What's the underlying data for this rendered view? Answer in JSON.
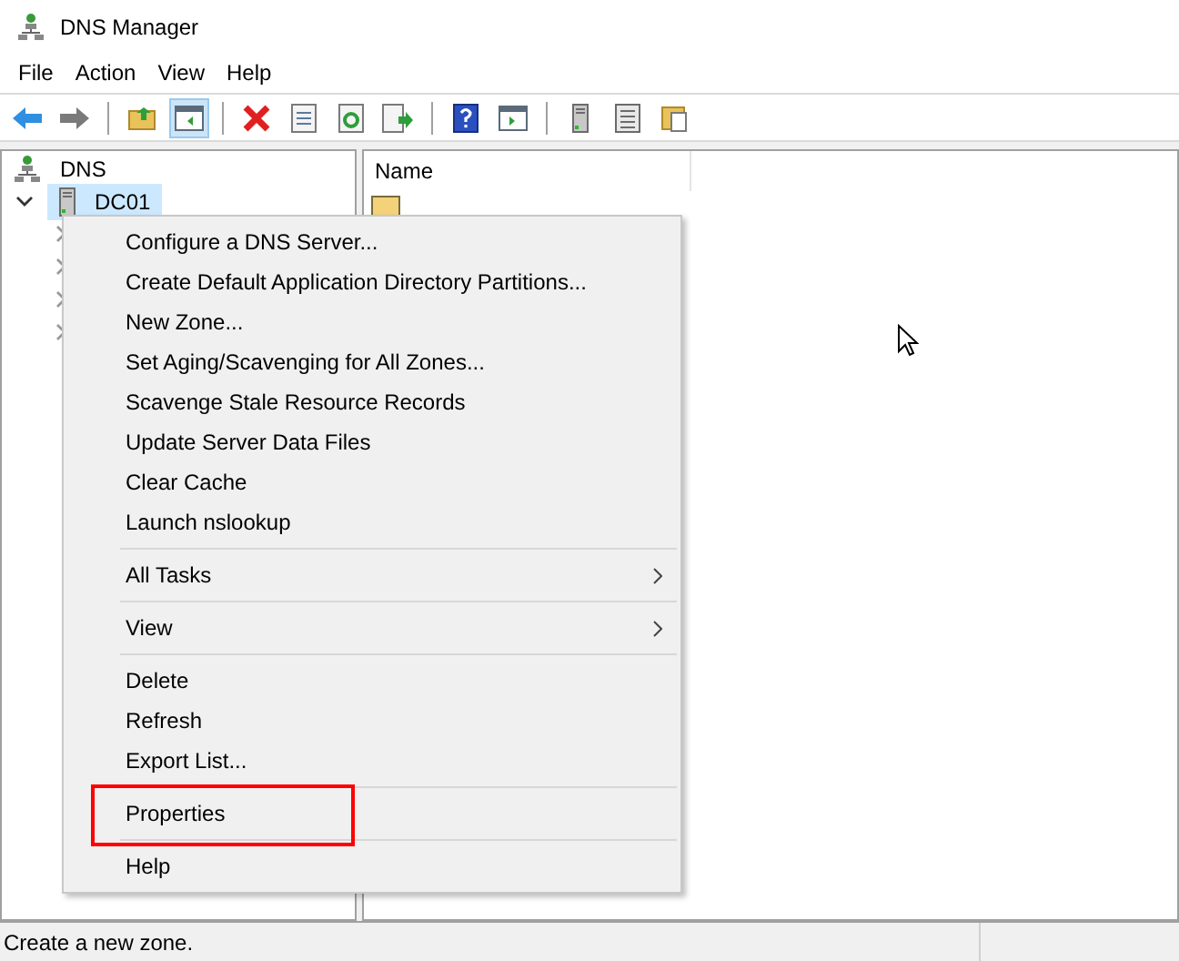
{
  "window": {
    "title": "DNS Manager"
  },
  "menu_bar": [
    "File",
    "Action",
    "View",
    "Help"
  ],
  "toolbar": [
    {
      "kind": "back",
      "selected": false
    },
    {
      "kind": "forward",
      "selected": false
    },
    {
      "kind": "separator"
    },
    {
      "kind": "up",
      "selected": false
    },
    {
      "kind": "tree",
      "selected": true
    },
    {
      "kind": "separator"
    },
    {
      "kind": "delete",
      "selected": false
    },
    {
      "kind": "properties",
      "selected": false
    },
    {
      "kind": "refresh",
      "selected": false
    },
    {
      "kind": "export",
      "selected": false
    },
    {
      "kind": "separator"
    },
    {
      "kind": "help",
      "selected": false
    },
    {
      "kind": "pane",
      "selected": false
    },
    {
      "kind": "separator"
    },
    {
      "kind": "server",
      "selected": false
    },
    {
      "kind": "list",
      "selected": false
    },
    {
      "kind": "folders",
      "selected": false
    }
  ],
  "tree": [
    {
      "label": "DNS",
      "selected": false,
      "children": [
        {
          "label": "DC01",
          "selected": true,
          "expanded": true,
          "children": [
            {
              "expanded": false
            },
            {
              "expanded": false
            },
            {
              "expanded": false
            },
            {
              "expanded": false
            }
          ]
        }
      ]
    }
  ],
  "list": {
    "columns": [
      "Name"
    ],
    "rows": [
      {
        "kind": "folder"
      }
    ]
  },
  "context_menu": [
    {
      "kind": "item",
      "label": "Configure a DNS Server...",
      "submenu": false,
      "highlighted": false
    },
    {
      "kind": "item",
      "label": "Create Default Application Directory Partitions...",
      "submenu": false,
      "highlighted": false
    },
    {
      "kind": "item",
      "label": "New Zone...",
      "submenu": false,
      "highlighted": false
    },
    {
      "kind": "item",
      "label": "Set Aging/Scavenging for All Zones...",
      "submenu": false,
      "highlighted": false
    },
    {
      "kind": "item",
      "label": "Scavenge Stale Resource Records",
      "submenu": false,
      "highlighted": false
    },
    {
      "kind": "item",
      "label": "Update Server Data Files",
      "submenu": false,
      "highlighted": false
    },
    {
      "kind": "item",
      "label": "Clear Cache",
      "submenu": false,
      "highlighted": false
    },
    {
      "kind": "item",
      "label": "Launch nslookup",
      "submenu": false,
      "highlighted": false
    },
    {
      "kind": "separator"
    },
    {
      "kind": "item",
      "label": "All Tasks",
      "submenu": true,
      "highlighted": false
    },
    {
      "kind": "separator"
    },
    {
      "kind": "item",
      "label": "View",
      "submenu": true,
      "highlighted": false
    },
    {
      "kind": "separator"
    },
    {
      "kind": "item",
      "label": "Delete",
      "submenu": false,
      "highlighted": false
    },
    {
      "kind": "item",
      "label": "Refresh",
      "submenu": false,
      "highlighted": false
    },
    {
      "kind": "item",
      "label": "Export List...",
      "submenu": false,
      "highlighted": false
    },
    {
      "kind": "separator"
    },
    {
      "kind": "item",
      "label": "Properties",
      "submenu": false,
      "highlighted": true
    },
    {
      "kind": "separator"
    },
    {
      "kind": "item",
      "label": "Help",
      "submenu": false,
      "highlighted": false
    }
  ],
  "status_bar": {
    "text": "Create a new zone."
  }
}
